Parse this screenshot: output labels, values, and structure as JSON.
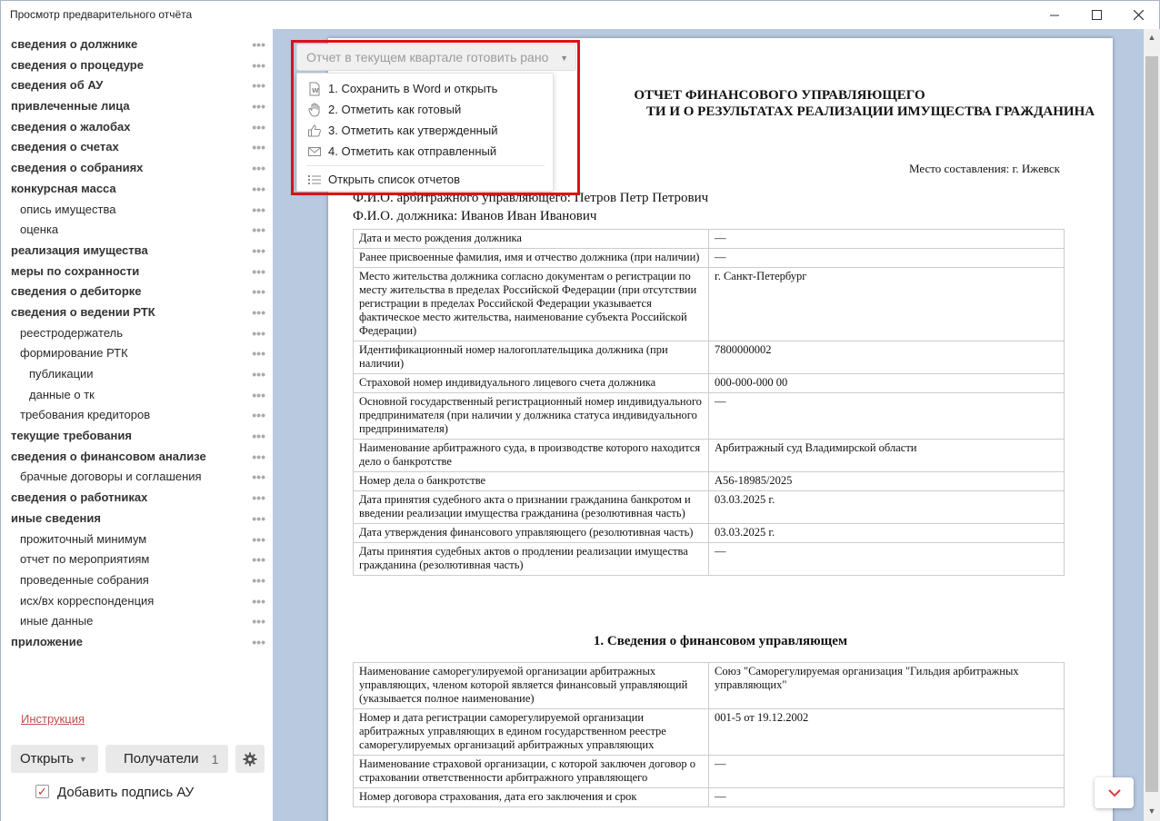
{
  "window": {
    "title": "Просмотр предварительного отчёта"
  },
  "sidebar": {
    "items": [
      {
        "label": "сведения о должнике",
        "level": 0
      },
      {
        "label": "сведения о процедуре",
        "level": 0
      },
      {
        "label": "сведения об АУ",
        "level": 0
      },
      {
        "label": "привлеченные лица",
        "level": 0
      },
      {
        "label": "сведения о жалобах",
        "level": 0
      },
      {
        "label": "сведения о счетах",
        "level": 0
      },
      {
        "label": "сведения о собраниях",
        "level": 0
      },
      {
        "label": "конкурсная масса",
        "level": 0
      },
      {
        "label": "опись имущества",
        "level": 1
      },
      {
        "label": "оценка",
        "level": 1
      },
      {
        "label": "реализация имущества",
        "level": 0
      },
      {
        "label": "меры по сохранности",
        "level": 0
      },
      {
        "label": "сведения о дебиторке",
        "level": 0
      },
      {
        "label": "сведения о ведении РТК",
        "level": 0
      },
      {
        "label": "реестродержатель",
        "level": 1
      },
      {
        "label": "формирование РТК",
        "level": 1
      },
      {
        "label": "публикации",
        "level": 2
      },
      {
        "label": "данные о тк",
        "level": 2
      },
      {
        "label": "требования кредиторов",
        "level": 1
      },
      {
        "label": "текущие требования",
        "level": 0
      },
      {
        "label": "сведения о финансовом анализе",
        "level": 0
      },
      {
        "label": "брачные договоры и соглашения",
        "level": 1
      },
      {
        "label": "сведения о работниках",
        "level": 0
      },
      {
        "label": "иные сведения",
        "level": 0
      },
      {
        "label": "прожиточный минимум",
        "level": 1
      },
      {
        "label": "отчет по мероприятиям",
        "level": 1
      },
      {
        "label": "проведенные собрания",
        "level": 1
      },
      {
        "label": "исх/вх корреспонденция",
        "level": 1
      },
      {
        "label": "иные данные",
        "level": 1
      },
      {
        "label": "приложение",
        "level": 0
      }
    ],
    "dots": "•••",
    "instruction_link": "Инструкция",
    "open_button": "Открыть",
    "recipients_button": "Получатели",
    "recipients_count": "1",
    "sign_checkbox_label": "Добавить подпись АУ",
    "sign_checked": true
  },
  "dropdown": {
    "label": "Отчет в текущем квартале готовить рано",
    "items": [
      {
        "label": "1. Сохранить в Word и открыть",
        "icon": "word-icon"
      },
      {
        "label": "2. Отметить как готовый",
        "icon": "hand-icon"
      },
      {
        "label": "3. Отметить как утвержденный",
        "icon": "thumbs-up-icon"
      },
      {
        "label": "4. Отметить как отправленный",
        "icon": "envelope-icon"
      }
    ],
    "open_list": {
      "label": "Открыть список отчетов",
      "icon": "list-icon"
    }
  },
  "document": {
    "title_line1": "ОТЧЕТ ФИНАНСОВОГО УПРАВЛЯЮЩЕГО",
    "title_line2": "ТИ И О РЕЗУЛЬТАТАХ РЕАЛИЗАЦИИ ИМУЩЕСТВА ГРАЖДАНИНА",
    "place": "Место составления: г. Ижевск",
    "manager_line": "Ф.И.О. арбитражного управляющего: Петров Петр Петрович",
    "debtor_line": "Ф.И.О. должника: Иванов Иван Иванович",
    "table1": [
      {
        "label": "Дата и место рождения должника",
        "value": "—"
      },
      {
        "label": "Ранее присвоенные фамилия, имя и отчество должника (при наличии)",
        "value": "—"
      },
      {
        "label": "Место жительства должника согласно документам о регистрации по месту жительства в пределах Российской Федерации (при отсутствии регистрации в пределах Российской Федерации указывается фактическое место жительства, наименование субъекта Российской Федерации)",
        "value": "г. Санкт-Петербург"
      },
      {
        "label": "Идентификационный номер налогоплательщика должника (при наличии)",
        "value": "7800000002"
      },
      {
        "label": "Страховой номер индивидуального лицевого счета должника",
        "value": "000-000-000 00"
      },
      {
        "label": "Основной государственный регистрационный номер индивидуального предпринимателя (при наличии у должника статуса индивидуального предпринимателя)",
        "value": "—"
      },
      {
        "label": "Наименование арбитражного суда, в производстве которого находится дело о банкротстве",
        "value": "Арбитражный суд Владимирской области"
      },
      {
        "label": "Номер дела о банкротстве",
        "value": "А56-18985/2025"
      },
      {
        "label": "Дата принятия судебного акта о признании гражданина банкротом и введении реализации имущества гражданина (резолютивная часть)",
        "value": "03.03.2025 г."
      },
      {
        "label": "Дата утверждения финансового управляющего (резолютивная часть)",
        "value": "03.03.2025 г."
      },
      {
        "label": "Даты принятия судебных актов о продлении реализации имущества гражданина (резолютивная часть)",
        "value": "—"
      }
    ],
    "section1_title": "1. Сведения о финансовом управляющем",
    "table2": [
      {
        "label": "Наименование саморегулируемой организации арбитражных управляющих, членом которой является финансовый управляющий (указывается полное наименование)",
        "value": "Союз \"Саморегулируемая организация \"Гильдия арбитражных управляющих\""
      },
      {
        "label": "Номер и дата регистрации саморегулируемой организации арбитражных управляющих в едином государственном реестре саморегулируемых организаций арбитражных управляющих",
        "value": "001-5 от 19.12.2002"
      },
      {
        "label": "Наименование страховой организации, с которой заключен договор о страховании ответственности арбитражного управляющего",
        "value": "—"
      },
      {
        "label": "Номер договора страхования, дата его заключения и срок",
        "value": "—"
      }
    ]
  }
}
